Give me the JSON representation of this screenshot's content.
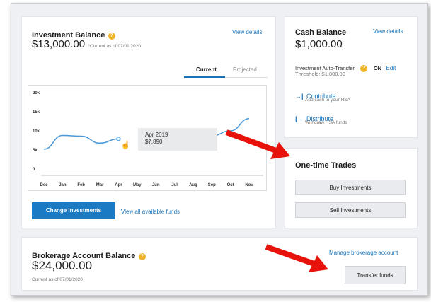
{
  "investment": {
    "title": "Investment Balance",
    "view_details": "View details",
    "amount": "$13,000.00",
    "as_of": "*Current as of 07/01/2020",
    "tabs": [
      {
        "label": "Current",
        "active": true
      },
      {
        "label": "Projected",
        "active": false
      }
    ],
    "tooltip": {
      "month": "Apr 2019",
      "value": "$7,890"
    },
    "change_button": "Change Investments",
    "view_funds": "View all available funds"
  },
  "chart_data": {
    "type": "line",
    "categories": [
      "Dec",
      "Jan",
      "Feb",
      "Mar",
      "Apr",
      "May",
      "Jun",
      "Jul",
      "Aug",
      "Sep",
      "Oct",
      "Nov"
    ],
    "y_ticks": [
      "20k",
      "15k",
      "10k",
      "5k",
      "0"
    ],
    "ylim": [
      0,
      20000
    ],
    "values": [
      5200,
      8800,
      8600,
      6800,
      7890,
      null,
      null,
      null,
      null,
      8700,
      10000,
      13200
    ],
    "grid": false,
    "color": "#4a98d8"
  },
  "cash": {
    "title": "Cash Balance",
    "view_details": "View details",
    "amount": "$1,000.00",
    "auto_transfer_label": "Investment Auto-Transfer",
    "auto_transfer_state": "ON",
    "edit": "Edit",
    "threshold": "Threshold: $1,000.00",
    "contribute": {
      "label": "Contribute",
      "desc": "Add cash to your HSA"
    },
    "distribute": {
      "label": "Distribute",
      "desc": "Withdraw HSA funds"
    }
  },
  "trades": {
    "title": "One-time Trades",
    "buy": "Buy Investments",
    "sell": "Sell Investments"
  },
  "brokerage": {
    "title": "Brokerage Account Balance",
    "manage": "Manage brokerage account",
    "amount": "$24,000.00",
    "as_of": "Current as of 07/01/2020",
    "transfer": "Transfer funds"
  },
  "colors": {
    "accent": "#1a7bc4",
    "help": "#f0b429",
    "arrow": "#e8120c"
  }
}
